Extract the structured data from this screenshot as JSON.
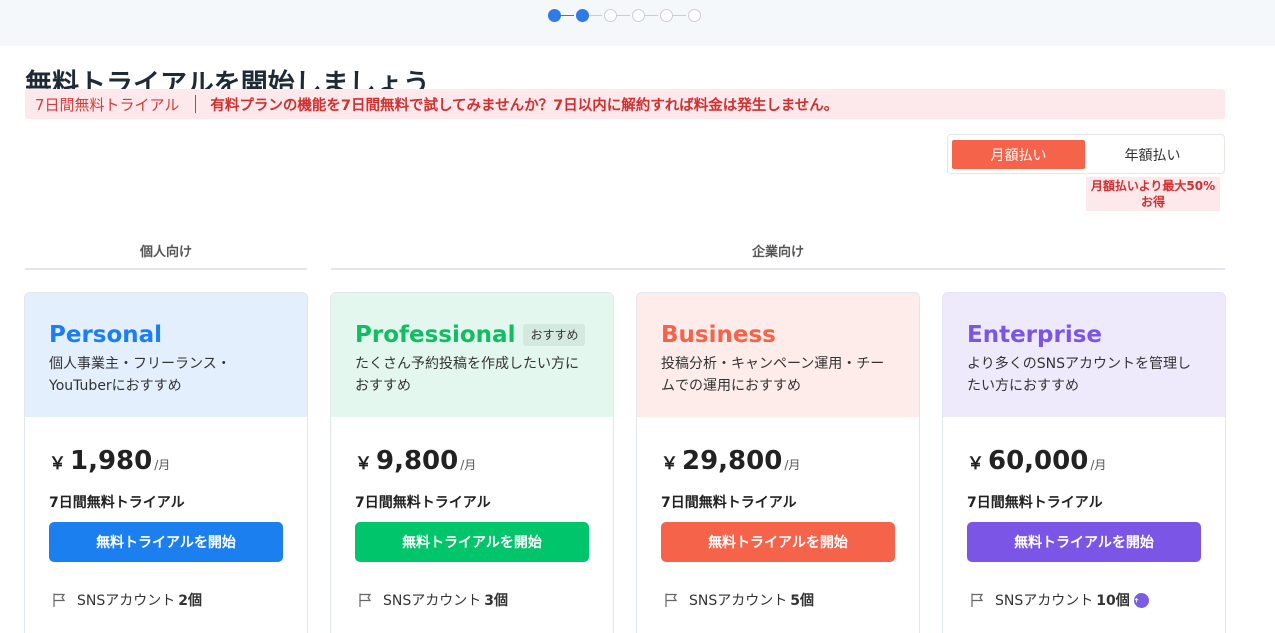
{
  "header": {
    "title": "無料トライアルを開始しましょう",
    "stepper": {
      "total": 6,
      "current": 2
    }
  },
  "banner": {
    "tag": "7日間無料トライアル",
    "message": "有料プランの機能を7日間無料で試してみませんか？7日以内に解約すれば料金は発生しません。"
  },
  "billing": {
    "monthly": "月額払い",
    "yearly": "年額払い",
    "selected": "monthly",
    "save_note": "月額払いより最大50%お得"
  },
  "segments": {
    "personal": "個人向け",
    "business": "企業向け"
  },
  "plans": [
    {
      "name": "Personal",
      "color": "#1b7ff0",
      "bg": "#e3effd",
      "badge": "",
      "desc": "個人事業主・フリーランス・YouTuberにおすすめ",
      "currency": "￥",
      "price": "1,980",
      "per": "/月",
      "trial": "7日間無料トライアル",
      "cta": "無料トライアルを開始",
      "btn": "#1b7ff0",
      "feature_label": "SNSアカウント",
      "feature_value": "2個"
    },
    {
      "name": "Professional",
      "color": "#0fbe63",
      "bg": "#e4f7ee",
      "badge": "おすすめ",
      "desc": "たくさん予約投稿を作成したい方におすすめ",
      "currency": "￥",
      "price": "9,800",
      "per": "/月",
      "trial": "7日間無料トライアル",
      "cta": "無料トライアルを開始",
      "btn": "#00c56a",
      "feature_label": "SNSアカウント",
      "feature_value": "3個"
    },
    {
      "name": "Business",
      "color": "#f4634a",
      "bg": "#fdecea",
      "badge": "",
      "desc": "投稿分析・キャンペーン運用・チームでの運用におすすめ",
      "currency": "￥",
      "price": "29,800",
      "per": "/月",
      "trial": "7日間無料トライアル",
      "cta": "無料トライアルを開始",
      "btn": "#f4634a",
      "feature_label": "SNSアカウント",
      "feature_value": "5個"
    },
    {
      "name": "Enterprise",
      "color": "#7a55e6",
      "bg": "#eeeafb",
      "badge": "",
      "desc": "より多くのSNSアカウントを管理したい方におすすめ",
      "currency": "￥",
      "price": "60,000",
      "per": "/月",
      "trial": "7日間無料トライアル",
      "cta": "無料トライアルを開始",
      "btn": "#7a55e6",
      "feature_label": "SNSアカウント",
      "feature_value": "10個"
    }
  ]
}
